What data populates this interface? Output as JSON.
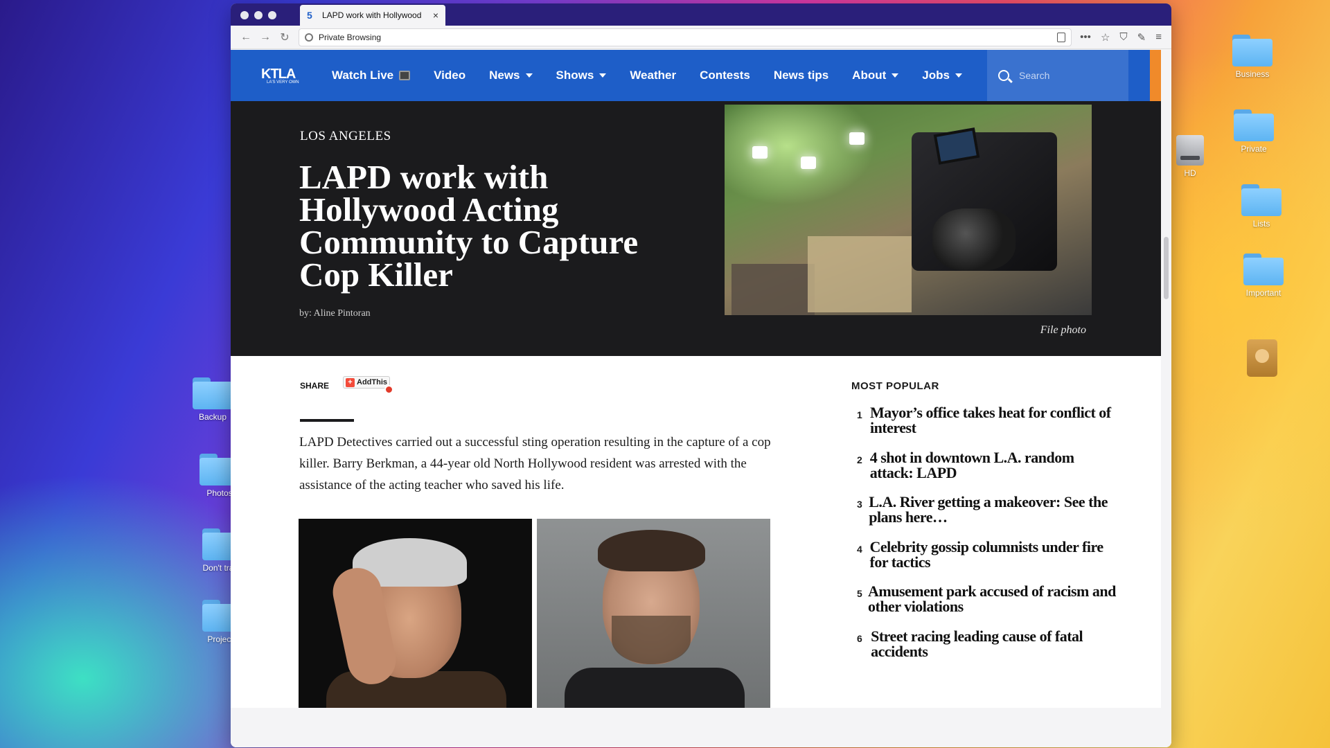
{
  "desktop": {
    "right_icons": [
      "Business",
      "Private",
      "Lists",
      "Important"
    ],
    "left_icons": [
      "Backup",
      "Photos",
      "Don't track",
      "Projects"
    ],
    "hd_label": "HD"
  },
  "browser": {
    "tab_title": "LAPD work with Hollywood",
    "tab_favicon": "5",
    "close_glyph": "×",
    "url_text": "Private Browsing",
    "icons": [
      "back-arrow-icon",
      "forward-arrow-icon",
      "reload-icon",
      "reader-view-icon",
      "more-icon",
      "bookmark-star-icon",
      "shield-icon",
      "extensions-icon",
      "menu-icon"
    ]
  },
  "site": {
    "logo": "KTLA",
    "logo_sub": "LA'S VERY OWN",
    "nav": [
      {
        "label": "Watch Live"
      },
      {
        "label": "Video"
      },
      {
        "label": "News"
      },
      {
        "label": "Shows"
      },
      {
        "label": "Weather"
      },
      {
        "label": "Contests"
      },
      {
        "label": "News tips"
      },
      {
        "label": "About"
      },
      {
        "label": "Jobs"
      }
    ],
    "search_placeholder": "Search"
  },
  "article": {
    "kicker": "LOS ANGELES",
    "headline": "LAPD work with Hollywood Acting Community to Capture Cop Killer",
    "byline": "by: Aline Pintoran",
    "caption": "File photo",
    "share_label": "SHARE",
    "addthis_label": "AddThis",
    "body": "LAPD Detectives carried out a successful sting operation resulting in the capture of a cop killer. Barry Berkman, a 44-year old North Hollywood resident was arrested with the assistance of the acting teacher who saved his life."
  },
  "popular": {
    "title": "MOST POPULAR",
    "items": [
      {
        "num": "1",
        "text": "Mayor’s office takes heat for conflict of interest"
      },
      {
        "num": "2",
        "text": "4 shot in downtown L.A. random attack: LAPD"
      },
      {
        "num": "3",
        "text": "L.A. River getting a makeover: See the plans here…"
      },
      {
        "num": "4",
        "text": "Celebrity gossip columnists under fire for tactics"
      },
      {
        "num": "5",
        "text": "Amusement park accused of racism and other violations"
      },
      {
        "num": "6",
        "text": "Street racing leading cause of fatal accidents"
      }
    ]
  }
}
